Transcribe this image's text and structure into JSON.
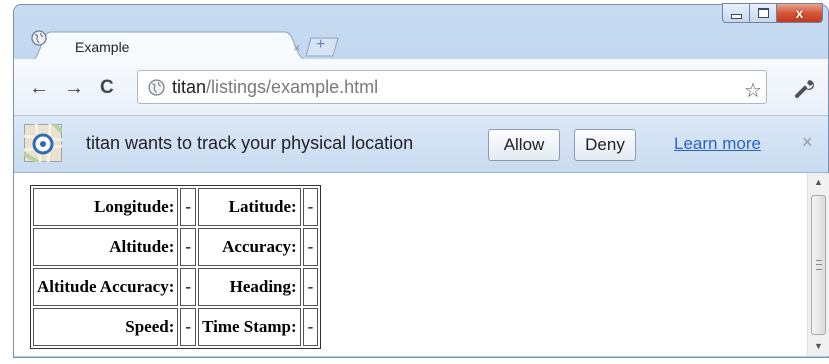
{
  "tab": {
    "title": "Example",
    "close_glyph": "×",
    "new_tab_glyph": "+"
  },
  "window_controls": {
    "close_glyph": "x"
  },
  "toolbar": {
    "back_glyph": "←",
    "forward_glyph": "→",
    "reload_glyph": "C",
    "url_host": "titan",
    "url_path": "/listings/example.html",
    "star_glyph": "☆"
  },
  "infobar": {
    "message": "titan wants to track your physical location",
    "allow_label": "Allow",
    "deny_label": "Deny",
    "learn_more_label": "Learn more",
    "close_glyph": "×"
  },
  "geo_table": {
    "rows": [
      {
        "k1": "Longitude:",
        "v1": "-",
        "k2": "Latitude:",
        "v2": "-"
      },
      {
        "k1": "Altitude:",
        "v1": "-",
        "k2": "Accuracy:",
        "v2": "-"
      },
      {
        "k1": "Altitude Accuracy:",
        "v1": "-",
        "k2": "Heading:",
        "v2": "-"
      },
      {
        "k1": "Speed:",
        "v1": "-",
        "k2": "Time Stamp:",
        "v2": "-"
      }
    ]
  },
  "icons": {
    "tab": "globe-icon",
    "omnibox": "globe-icon",
    "bookmark": "star-icon",
    "menu": "wrench-icon",
    "infobar": "location-map-icon"
  }
}
